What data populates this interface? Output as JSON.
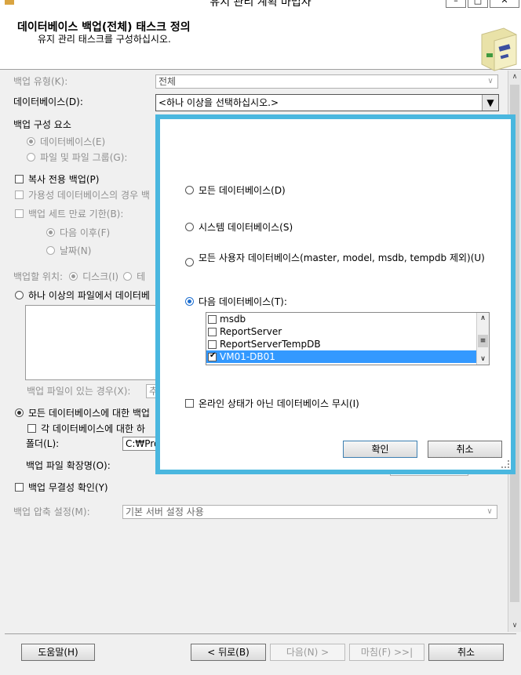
{
  "window": {
    "title": "유지 관리 계획 마법사"
  },
  "header": {
    "title": "데이터베이스 백업(전체) 태스크 정의",
    "subtitle": "유지 관리 태스크를 구성하십시오."
  },
  "form": {
    "backup_type_label": "백업 유형(K):",
    "backup_type_value": "전체",
    "database_label": "데이터베이스(D):",
    "database_value": "<하나 이상을 선택하십시오.>",
    "backup_component_label": "백업 구성 요소",
    "component_database": "데이터베이스(E)",
    "component_files": "파일 및 파일 그룹(G):",
    "copy_only": "복사 전용 백업(P)",
    "available_db_partial": "가용성 데이터베이스의 경우 백",
    "expire_label": "백업 세트 만료 기한(B):",
    "expire_after": "다음 이후(F)",
    "expire_date": "날짜(N)",
    "backup_to_label": "백업할 위치:",
    "backup_to_disk": "디스크(I)",
    "backup_to_tape_partial": "테",
    "one_or_more_files": "하나 이상의 파일에서 데이터베",
    "if_backup_exists": "백업 파일이 있는 경우(X):",
    "if_backup_exists_value": "추",
    "per_db_files": "모든 데이터베이스에 대한 백업",
    "per_db_subdir": "각 데이터베이스에 대한 하",
    "folder_label": "폴더(L):",
    "folder_value": "C:₩Pro",
    "extension_label": "백업 파일 확장명(O):",
    "verify_integrity": "백업 무결성 확인(Y)",
    "compression_label": "백업 압축 설정(M):",
    "compression_value": "기본 서버 설정 사용"
  },
  "popup": {
    "option_all": "모든 데이터베이스(D)",
    "option_system": "시스템 데이터베이스(S)",
    "option_user": "모든 사용자 데이터베이스(master, model, msdb, tempdb 제외)(U)",
    "option_these": "다음 데이터베이스(T):",
    "selected_option": "these",
    "databases": [
      {
        "name": "msdb",
        "checked": false
      },
      {
        "name": "ReportServer",
        "checked": false
      },
      {
        "name": "ReportServerTempDB",
        "checked": false
      },
      {
        "name": "VM01-DB01",
        "checked": true
      }
    ],
    "ignore_offline": "온라인 상태가 아닌 데이터베이스 무시(I)",
    "ok": "확인",
    "cancel": "취소"
  },
  "footer": {
    "help": "도움말(H)",
    "back": "< 뒤로(B)",
    "next": "다음(N) >",
    "finish": "마침(F) >>|",
    "cancel": "취소"
  },
  "colors": {
    "popup_border": "#4ab7df",
    "selection": "#3399ff"
  }
}
